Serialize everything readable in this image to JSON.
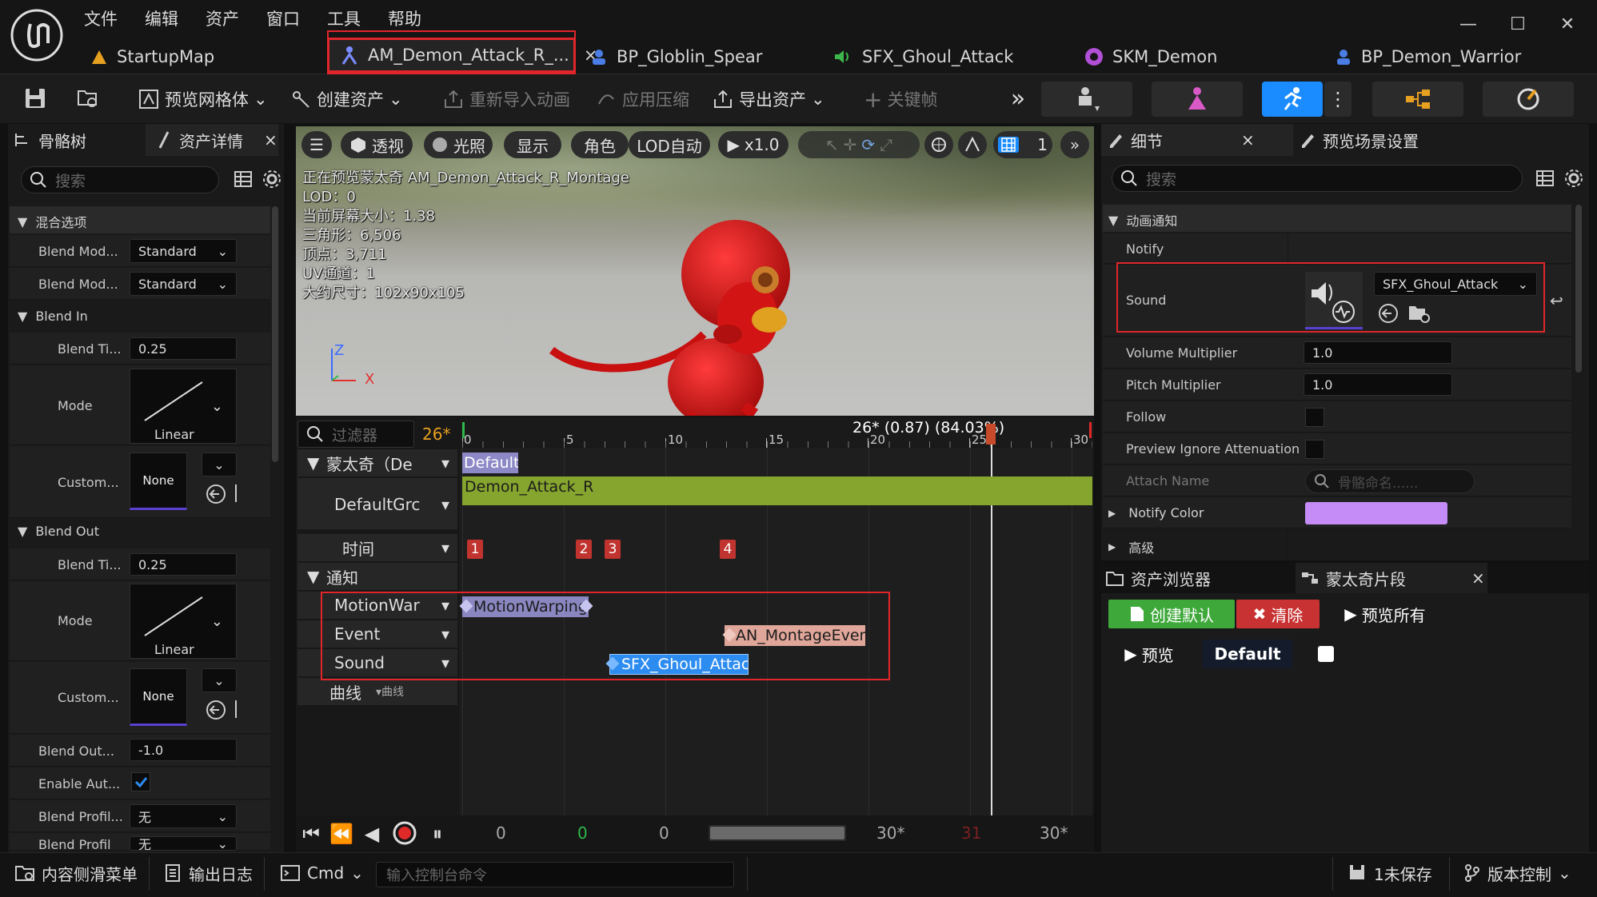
{
  "menu": [
    "文件",
    "编辑",
    "资产",
    "窗口",
    "工具",
    "帮助"
  ],
  "tabs": [
    {
      "label": "StartupMap",
      "icon": "map-icon"
    },
    {
      "label": "AM_Demon_Attack_R_...",
      "icon": "montage-icon",
      "close": "×"
    },
    {
      "label": "BP_Globlin_Spear",
      "icon": "blueprint-icon"
    },
    {
      "label": "SFX_Ghoul_Attack",
      "icon": "sound-icon"
    },
    {
      "label": "SKM_Demon",
      "icon": "skeletal-mesh-icon"
    },
    {
      "label": "BP_Demon_Warrior",
      "icon": "blueprint-icon"
    }
  ],
  "toolbar": {
    "preview_mesh": "预览网格体",
    "create_asset": "创建资产",
    "reimport": "重新导入动画",
    "apply_compression": "应用压缩",
    "export_asset": "导出资产",
    "key": "关键帧"
  },
  "left": {
    "tab1": "骨骼树",
    "tab2": "资产详情",
    "close": "×",
    "search_placeholder": "搜索",
    "cat_blend": "混合选项",
    "blend_mode1_label": "Blend Mod...",
    "blend_mode1": "Standard",
    "blend_mode2_label": "Blend Mod...",
    "blend_mode2": "Standard",
    "blend_in": "Blend In",
    "bi_time_label": "Blend Ti...",
    "bi_time": "0.25",
    "bi_mode_label": "Mode",
    "bi_mode": "Linear",
    "bi_custom_label": "Custom...",
    "bi_custom": "None",
    "blend_out": "Blend Out",
    "bo_time_label": "Blend Ti...",
    "bo_time": "0.25",
    "bo_mode_label": "Mode",
    "bo_mode": "Linear",
    "bo_custom_label": "Custom...",
    "bo_custom": "None",
    "blend_out_trigger_label": "Blend Out...",
    "blend_out_trigger": "-1.0",
    "enable_auto_label": "Enable Aut...",
    "blend_profile1_label": "Blend Profil...",
    "blend_profile1": "无",
    "blend_profile2_label": "Blend Profil",
    "blend_profile2": "无"
  },
  "viewport": {
    "btn_perspective": "透视",
    "btn_lit": "光照",
    "btn_show": "显示",
    "btn_character": "角色",
    "btn_lod": "LOD自动",
    "btn_speed": "x1.0",
    "grid_num": "1",
    "stats": [
      "正在预览蒙太奇 AM_Demon_Attack_R_Montage",
      "LOD：0",
      "当前屏幕大小：1.38",
      "三角形：6,506",
      "顶点：3,711",
      "UV通道：1",
      "大约尺寸：102x90x105"
    ],
    "axis_z": "Z",
    "axis_x": "X"
  },
  "timeline": {
    "filter_placeholder": "过滤器",
    "frame_count": "26*",
    "tracks": {
      "montage": "蒙太奇（De",
      "default_group": "DefaultGrc",
      "time": "时间",
      "notify": "通知",
      "motion": "MotionWar",
      "event": "Event",
      "sound": "Sound",
      "curve": "曲线",
      "curve_btn": "▾曲线"
    },
    "ruler": [
      "0",
      "5",
      "10",
      "15",
      "20",
      "25",
      "30"
    ],
    "playhead_label": "26* (0.87) (84.03%)",
    "slot_label": "Default",
    "segment_label": "Demon_Attack_R",
    "sections": [
      "1",
      "2",
      "3",
      "4"
    ],
    "notifies": {
      "motion": "MotionWarping",
      "event": "AN_MontageEvent",
      "sound": "SFX_Ghoul_Attack"
    },
    "bottom": {
      "a": "0",
      "b": "0",
      "c": "0",
      "d": "30*",
      "e": "31",
      "f": "30*"
    }
  },
  "details": {
    "tab1": "细节",
    "tab2": "预览场景设置",
    "close": "×",
    "search_placeholder": "搜索",
    "cat": "动画通知",
    "notify": "Notify",
    "sound_label": "Sound",
    "sound_value": "SFX_Ghoul_Attack",
    "volume_label": "Volume Multiplier",
    "volume": "1.0",
    "pitch_label": "Pitch Multiplier",
    "pitch": "1.0",
    "follow_label": "Follow",
    "preview_ignore_label": "Preview Ignore Attenuation",
    "attach_label": "Attach Name",
    "attach_placeholder": "骨骼命名......",
    "notify_color_label": "Notify Color",
    "notify_color": "#c58cf7",
    "advanced": "高级"
  },
  "bottom_right": {
    "tab1": "资产浏览器",
    "tab2": "蒙太奇片段",
    "close": "×",
    "create_default": "创建默认",
    "clear": "清除",
    "preview_all": "预览所有",
    "preview": "预览",
    "default": "Default"
  },
  "statusbar": {
    "content_drawer": "内容侧滑菜单",
    "output_log": "输出日志",
    "cmd": "Cmd",
    "console_placeholder": "输入控制台命令",
    "unsaved": "1未保存",
    "source_control": "版本控制"
  }
}
